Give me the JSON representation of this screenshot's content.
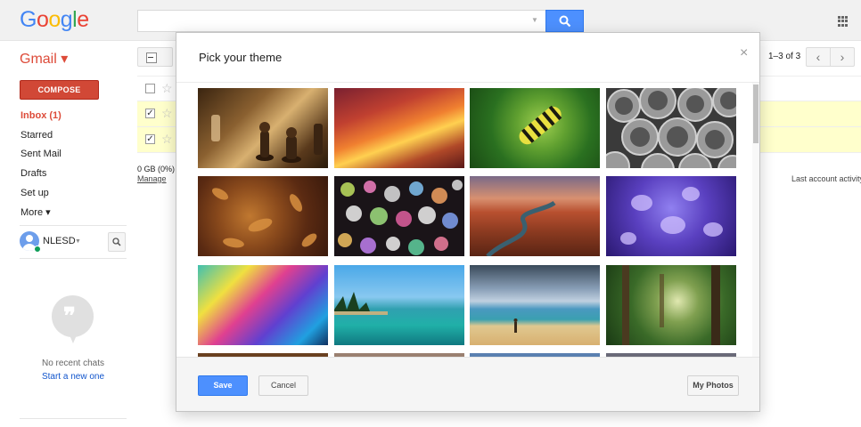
{
  "header": {
    "logo": [
      {
        "char": "G",
        "color": "#4285f4"
      },
      {
        "char": "o",
        "color": "#ea4335"
      },
      {
        "char": "o",
        "color": "#fbbc05"
      },
      {
        "char": "g",
        "color": "#4285f4"
      },
      {
        "char": "l",
        "color": "#34a853"
      },
      {
        "char": "e",
        "color": "#ea4335"
      }
    ],
    "search_value": "",
    "search_icon": "search-icon",
    "apps_icon": "apps-grid-icon"
  },
  "sidebar": {
    "app_label": "Gmail ▾",
    "compose_label": "COMPOSE",
    "items": [
      {
        "label": "Inbox (1)",
        "name": "inbox"
      },
      {
        "label": "Starred",
        "name": "starred"
      },
      {
        "label": "Sent Mail",
        "name": "sent-mail"
      },
      {
        "label": "Drafts",
        "name": "drafts"
      },
      {
        "label": "Set up",
        "name": "set-up"
      },
      {
        "label": "More ▾",
        "name": "more"
      }
    ],
    "user_name": "NLESD",
    "chat_empty": "No recent chats",
    "chat_start": "Start a new one"
  },
  "main": {
    "pager_text": "1–3 of 3",
    "storage": "0 GB (0%)",
    "manage": "Manage",
    "last_activity": "Last account activity"
  },
  "dialog": {
    "title": "Pick your theme",
    "close": "×",
    "save": "Save",
    "cancel": "Cancel",
    "my_photos": "My Photos"
  },
  "colors": {
    "accent_blue": "#4d90fe",
    "compose_red": "#d14836",
    "unread_row": "#ffffcc"
  }
}
